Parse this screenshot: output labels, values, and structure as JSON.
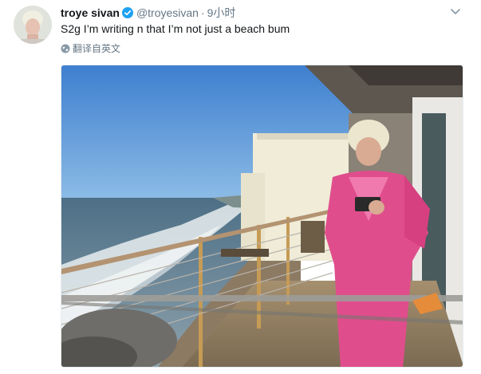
{
  "tweet": {
    "display_name": "troye sivan",
    "screen_name": "@troyesivan",
    "separator": "·",
    "time": "9小时",
    "text": "S2g I’m writing n that I’m not just a beach bum",
    "translate_label": "翻译自英文"
  },
  "icons": {
    "verified": "verified-badge-icon",
    "caret": "chevron-down-icon",
    "translate": "globe-icon"
  },
  "colors": {
    "verified_blue": "#1da1f2",
    "muted_text": "#657786",
    "primary_text": "#14171a"
  }
}
